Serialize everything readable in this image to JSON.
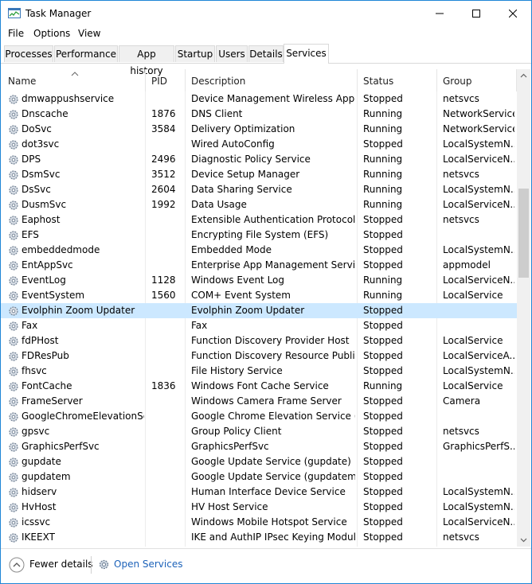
{
  "window": {
    "title": "Task Manager"
  },
  "menu": [
    "File",
    "Options",
    "View"
  ],
  "tabs": [
    "Processes",
    "Performance",
    "App history",
    "Startup",
    "Users",
    "Details",
    "Services"
  ],
  "active_tab": "Services",
  "columns": {
    "name": "Name",
    "pid": "PID",
    "description": "Description",
    "status": "Status",
    "group": "Group"
  },
  "rows": [
    {
      "name": "dmwappushservice",
      "pid": "",
      "description": "Device Management Wireless Applic...",
      "status": "Stopped",
      "group": "netsvcs"
    },
    {
      "name": "Dnscache",
      "pid": "1876",
      "description": "DNS Client",
      "status": "Running",
      "group": "NetworkService"
    },
    {
      "name": "DoSvc",
      "pid": "3584",
      "description": "Delivery Optimization",
      "status": "Running",
      "group": "NetworkService"
    },
    {
      "name": "dot3svc",
      "pid": "",
      "description": "Wired AutoConfig",
      "status": "Stopped",
      "group": "LocalSystemN..."
    },
    {
      "name": "DPS",
      "pid": "2496",
      "description": "Diagnostic Policy Service",
      "status": "Running",
      "group": "LocalServiceN..."
    },
    {
      "name": "DsmSvc",
      "pid": "3512",
      "description": "Device Setup Manager",
      "status": "Running",
      "group": "netsvcs"
    },
    {
      "name": "DsSvc",
      "pid": "2604",
      "description": "Data Sharing Service",
      "status": "Running",
      "group": "LocalSystemN..."
    },
    {
      "name": "DusmSvc",
      "pid": "1992",
      "description": "Data Usage",
      "status": "Running",
      "group": "LocalServiceN..."
    },
    {
      "name": "Eaphost",
      "pid": "",
      "description": "Extensible Authentication Protocol",
      "status": "Stopped",
      "group": "netsvcs"
    },
    {
      "name": "EFS",
      "pid": "",
      "description": "Encrypting File System (EFS)",
      "status": "Stopped",
      "group": ""
    },
    {
      "name": "embeddedmode",
      "pid": "",
      "description": "Embedded Mode",
      "status": "Stopped",
      "group": "LocalSystemN..."
    },
    {
      "name": "EntAppSvc",
      "pid": "",
      "description": "Enterprise App Management Service",
      "status": "Stopped",
      "group": "appmodel"
    },
    {
      "name": "EventLog",
      "pid": "1128",
      "description": "Windows Event Log",
      "status": "Running",
      "group": "LocalServiceN..."
    },
    {
      "name": "EventSystem",
      "pid": "1560",
      "description": "COM+ Event System",
      "status": "Running",
      "group": "LocalService"
    },
    {
      "name": "Evolphin Zoom Updater",
      "pid": "",
      "description": "Evolphin Zoom Updater",
      "status": "Stopped",
      "group": "",
      "selected": true
    },
    {
      "name": "Fax",
      "pid": "",
      "description": "Fax",
      "status": "Stopped",
      "group": ""
    },
    {
      "name": "fdPHost",
      "pid": "",
      "description": "Function Discovery Provider Host",
      "status": "Stopped",
      "group": "LocalService"
    },
    {
      "name": "FDResPub",
      "pid": "",
      "description": "Function Discovery Resource Public...",
      "status": "Stopped",
      "group": "LocalServiceA..."
    },
    {
      "name": "fhsvc",
      "pid": "",
      "description": "File History Service",
      "status": "Stopped",
      "group": "LocalSystemN..."
    },
    {
      "name": "FontCache",
      "pid": "1836",
      "description": "Windows Font Cache Service",
      "status": "Running",
      "group": "LocalService"
    },
    {
      "name": "FrameServer",
      "pid": "",
      "description": "Windows Camera Frame Server",
      "status": "Stopped",
      "group": "Camera"
    },
    {
      "name": "GoogleChromeElevationSer...",
      "pid": "",
      "description": "Google Chrome Elevation Service (G...",
      "status": "Stopped",
      "group": ""
    },
    {
      "name": "gpsvc",
      "pid": "",
      "description": "Group Policy Client",
      "status": "Stopped",
      "group": "netsvcs"
    },
    {
      "name": "GraphicsPerfSvc",
      "pid": "",
      "description": "GraphicsPerfSvc",
      "status": "Stopped",
      "group": "GraphicsPerfS..."
    },
    {
      "name": "gupdate",
      "pid": "",
      "description": "Google Update Service (gupdate)",
      "status": "Stopped",
      "group": ""
    },
    {
      "name": "gupdatem",
      "pid": "",
      "description": "Google Update Service (gupdatem)",
      "status": "Stopped",
      "group": ""
    },
    {
      "name": "hidserv",
      "pid": "",
      "description": "Human Interface Device Service",
      "status": "Stopped",
      "group": "LocalSystemN..."
    },
    {
      "name": "HvHost",
      "pid": "",
      "description": "HV Host Service",
      "status": "Stopped",
      "group": "LocalSystemN..."
    },
    {
      "name": "icssvc",
      "pid": "",
      "description": "Windows Mobile Hotspot Service",
      "status": "Stopped",
      "group": "LocalServiceN..."
    },
    {
      "name": "IKEEXT",
      "pid": "",
      "description": "IKE and AuthIP IPsec Keying Modules",
      "status": "Stopped",
      "group": "netsvcs"
    }
  ],
  "footer": {
    "fewer_details": "Fewer details",
    "open_services": "Open Services"
  },
  "colors": {
    "selected_row": "#cce8ff",
    "accent": "#1c62b9",
    "window_border": "#1f86d6"
  }
}
